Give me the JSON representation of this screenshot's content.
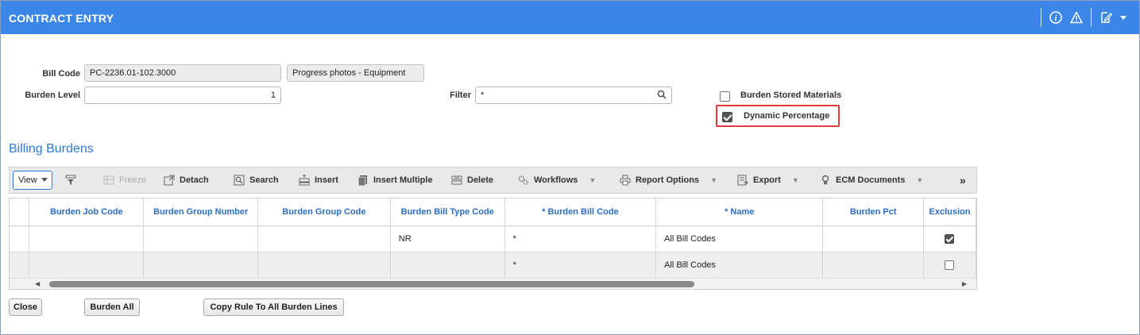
{
  "window": {
    "title": "CONTRACT ENTRY"
  },
  "header_icons": [
    "info-icon",
    "warning-icon",
    "edit-note-icon",
    "chevron-down-icon"
  ],
  "form": {
    "bill_code_label": "Bill Code",
    "bill_code_value": "PC-2236.01-102.3000",
    "bill_code_desc": "Progress photos - Equipment",
    "burden_level_label": "Burden Level",
    "burden_level_value": "1",
    "filter_label": "Filter",
    "filter_value": "*",
    "burden_stored_materials_label": "Burden Stored Materials",
    "burden_stored_materials_checked": false,
    "dynamic_percentage_label": "Dynamic Percentage",
    "dynamic_percentage_checked": true
  },
  "section": {
    "title": "Billing Burdens"
  },
  "toolbar": {
    "view": "View",
    "freeze": "Freeze",
    "detach": "Detach",
    "search": "Search",
    "insert": "Insert",
    "insert_multiple": "Insert Multiple",
    "delete": "Delete",
    "workflows": "Workflows",
    "report_options": "Report Options",
    "export": "Export",
    "ecm_documents": "ECM Documents",
    "more": "»"
  },
  "grid": {
    "columns": [
      "Burden Job Code",
      "Burden Group Number",
      "Burden Group Code",
      "Burden Bill Type Code",
      "* Burden Bill Code",
      "* Name",
      "Burden Pct",
      "Exclusion"
    ],
    "rows": [
      {
        "job_code": "",
        "group_number": "",
        "group_code": "",
        "bill_type": "NR",
        "bill_code": "*",
        "name": "All Bill Codes",
        "pct": "",
        "exclusion": true
      },
      {
        "job_code": "",
        "group_number": "",
        "group_code": "",
        "bill_type": "",
        "bill_code": "*",
        "name": "All Bill Codes",
        "pct": "",
        "exclusion": false
      }
    ]
  },
  "footer": {
    "close": "Close",
    "burden_all": "Burden All",
    "copy_rule": "Copy Rule To All Burden Lines"
  },
  "colors": {
    "title_bar": "#3b86e6",
    "link_blue": "#2d7ad6",
    "highlight_border": "#e03c3c"
  }
}
